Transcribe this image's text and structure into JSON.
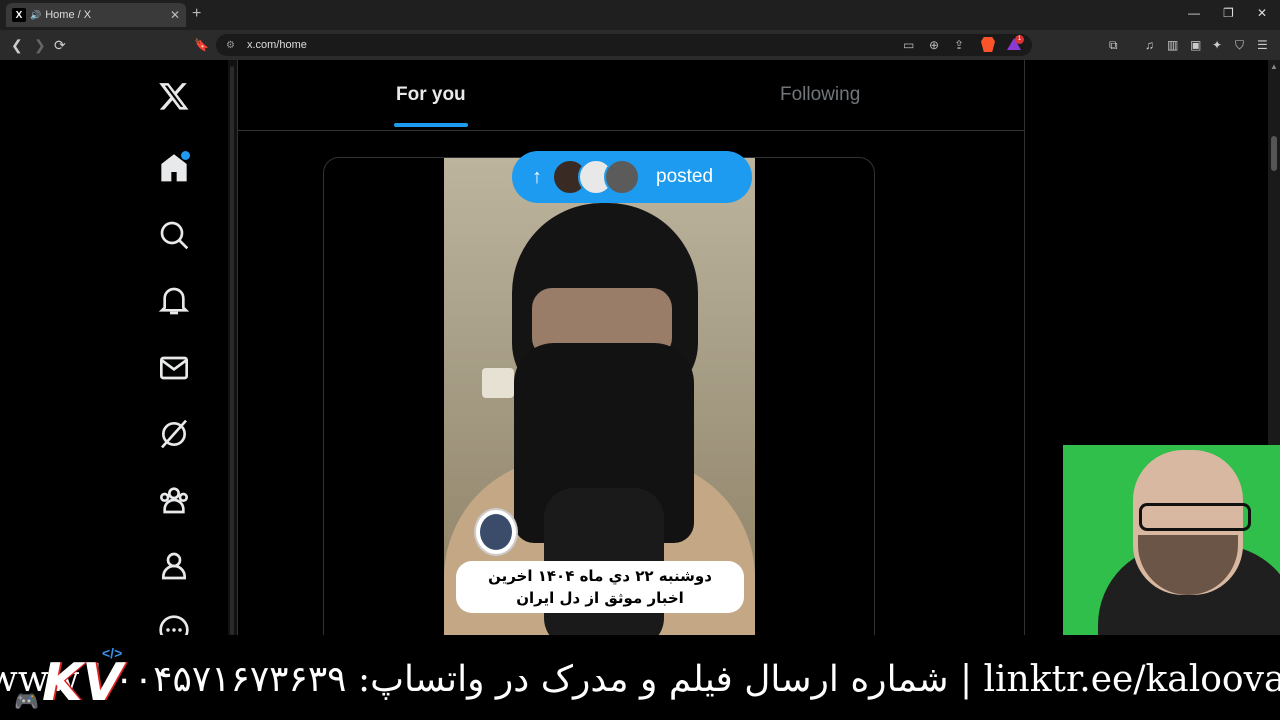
{
  "browser": {
    "tab_title": "Home / X",
    "tab_favicon": "X",
    "new_tab": "+",
    "url": "x.com/home",
    "window_controls": [
      "—",
      "❐",
      "✕"
    ],
    "brave_badge": "1"
  },
  "timeline": {
    "tabs": [
      {
        "label": "For you",
        "active": true
      },
      {
        "label": "Following",
        "active": false
      }
    ],
    "posted_pill": {
      "arrow": "↑",
      "label": "posted"
    },
    "video_caption_line1": "دوشنبه ۲۲ دي ماه ۱۴۰۴ اخرين",
    "video_caption_line2": "اخبار موثق از دل ايران"
  },
  "left_nav": {
    "items": [
      "x-logo-icon",
      "home-icon",
      "search-icon",
      "bell-icon",
      "mail-icon",
      "grok-icon",
      "communities-icon",
      "profile-icon",
      "more-icon"
    ]
  },
  "banner": {
    "text": "www | شماره ارسال فیلم و مدرک در واتساپ: ۰۰۴۵۷۱۶۷۳۶۳۹ | linktr.ee/kaloovaloo",
    "logo_letters": "KV",
    "logo_code": "</>"
  },
  "colors": {
    "accent": "#1d9bf0",
    "background": "#000000",
    "border": "#2f3336",
    "muted_text": "#71767b"
  }
}
